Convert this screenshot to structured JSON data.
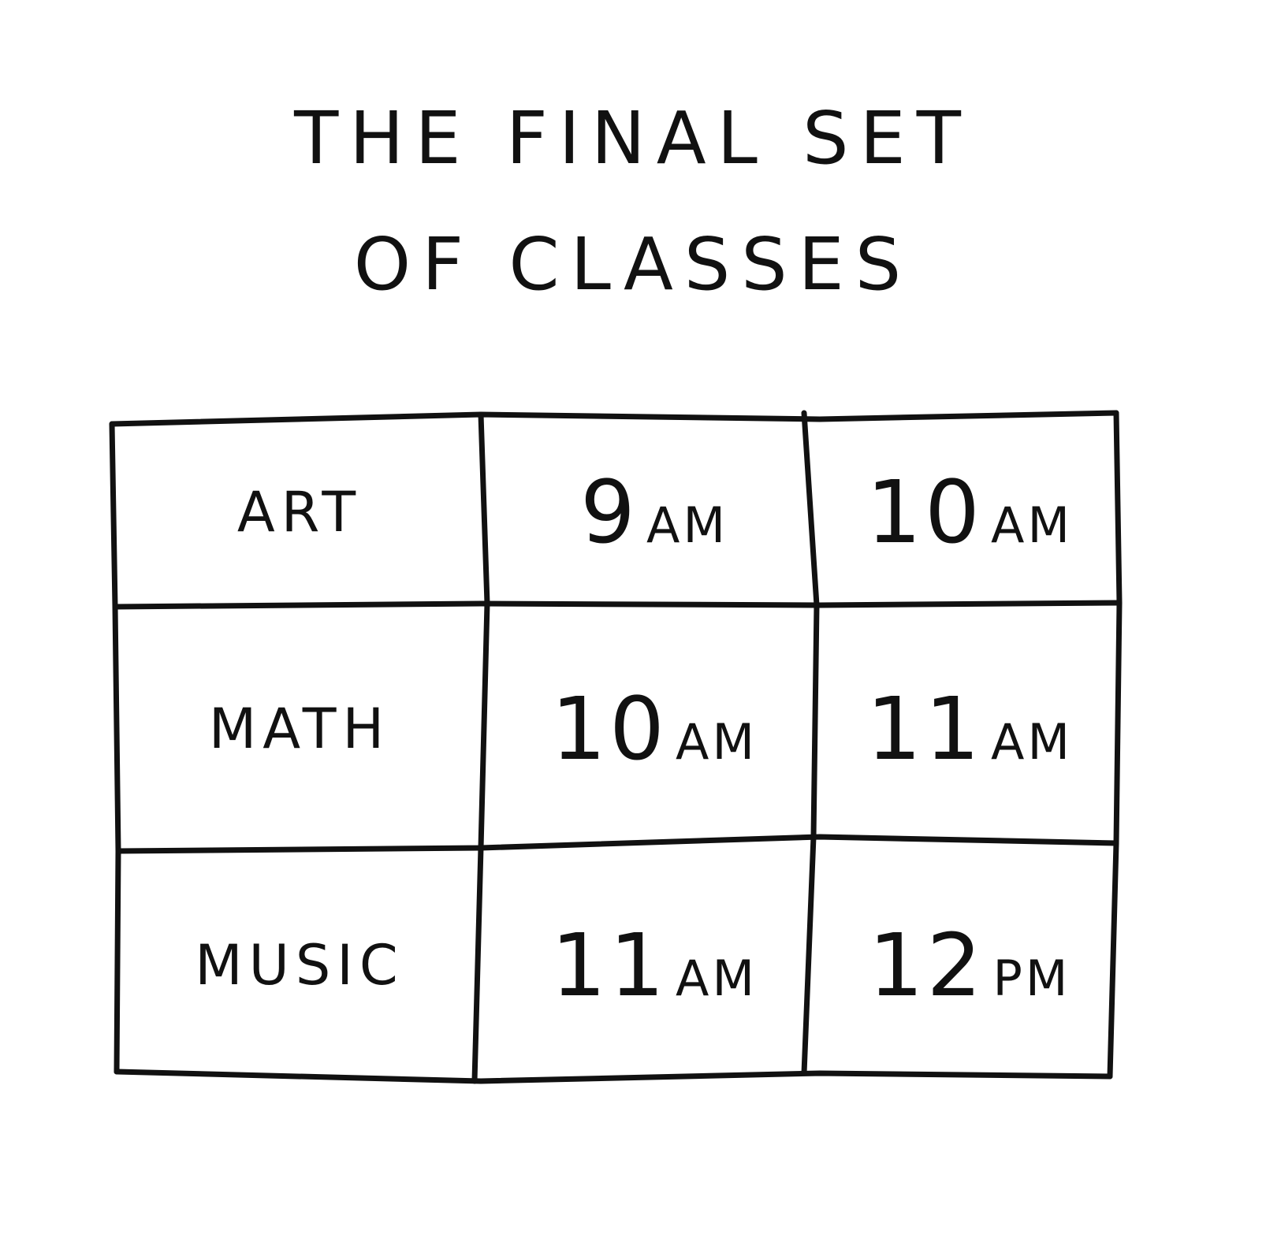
{
  "title": {
    "line1": "THE FINAL SET",
    "line2": "OF CLASSES"
  },
  "table": {
    "rows": [
      {
        "class": "ART",
        "times": [
          {
            "num": "9",
            "suffix": "AM"
          },
          {
            "num": "10",
            "suffix": "AM"
          }
        ]
      },
      {
        "class": "MATH",
        "times": [
          {
            "num": "10",
            "suffix": "AM"
          },
          {
            "num": "11",
            "suffix": "AM"
          }
        ]
      },
      {
        "class": "MUSIC",
        "times": [
          {
            "num": "11",
            "suffix": "AM"
          },
          {
            "num": "12",
            "suffix": "PM"
          }
        ]
      }
    ]
  },
  "colors": {
    "ink": "#111111",
    "paper": "#ffffff"
  }
}
